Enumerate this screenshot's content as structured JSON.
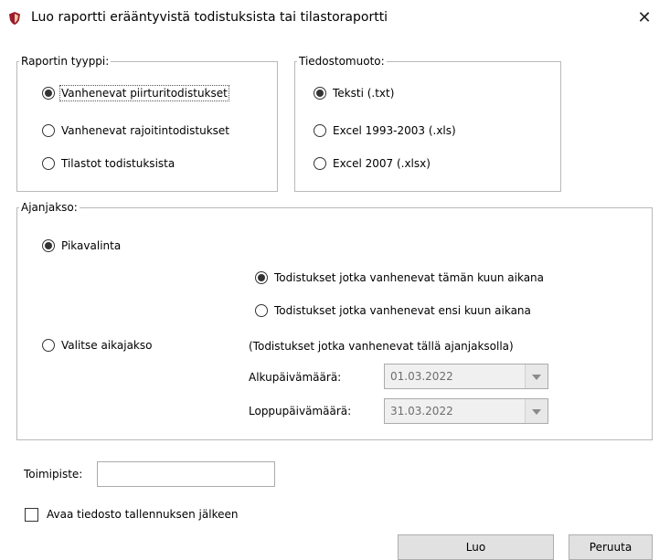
{
  "window": {
    "title": "Luo raportti erääntyvistä todistuksista tai tilastoraportti",
    "close_symbol": "✕",
    "app_icon": "shield-icon"
  },
  "report_type": {
    "legend": "Raportin tyyppi:",
    "options": [
      {
        "label": "Vanhenevat piirturitodistukset",
        "checked": true
      },
      {
        "label": "Vanhenevat rajoitintodistukset",
        "checked": false
      },
      {
        "label": "Tilastot todistuksista",
        "checked": false
      }
    ]
  },
  "file_format": {
    "legend": "Tiedostomuoto:",
    "options": [
      {
        "label": "Teksti (.txt)",
        "checked": true
      },
      {
        "label": "Excel 1993-2003 (.xls)",
        "checked": false
      },
      {
        "label": "Excel 2007 (.xlsx)",
        "checked": false
      }
    ]
  },
  "period": {
    "legend": "Ajanjakso:",
    "quick": {
      "label": "Pikavalinta",
      "checked": true
    },
    "quick_options": [
      {
        "label": "Todistukset jotka vanhenevat tämän kuun aikana",
        "checked": true
      },
      {
        "label": "Todistukset jotka vanhenevat ensi kuun aikana",
        "checked": false
      }
    ],
    "custom": {
      "label": "Valitse aikajakso",
      "checked": false
    },
    "custom_hint": "(Todistukset jotka vanhenevat tällä ajanjaksolla)",
    "start_label": "Alkupäivämäärä:",
    "start_value": "01.03.2022",
    "end_label": "Loppupäivämäärä:",
    "end_value": "31.03.2022"
  },
  "office": {
    "label": "Toimipiste:",
    "value": ""
  },
  "open_after_save": {
    "label": "Avaa tiedosto tallennuksen jälkeen",
    "checked": false
  },
  "buttons": {
    "create": "Luo",
    "cancel": "Peruuta"
  }
}
